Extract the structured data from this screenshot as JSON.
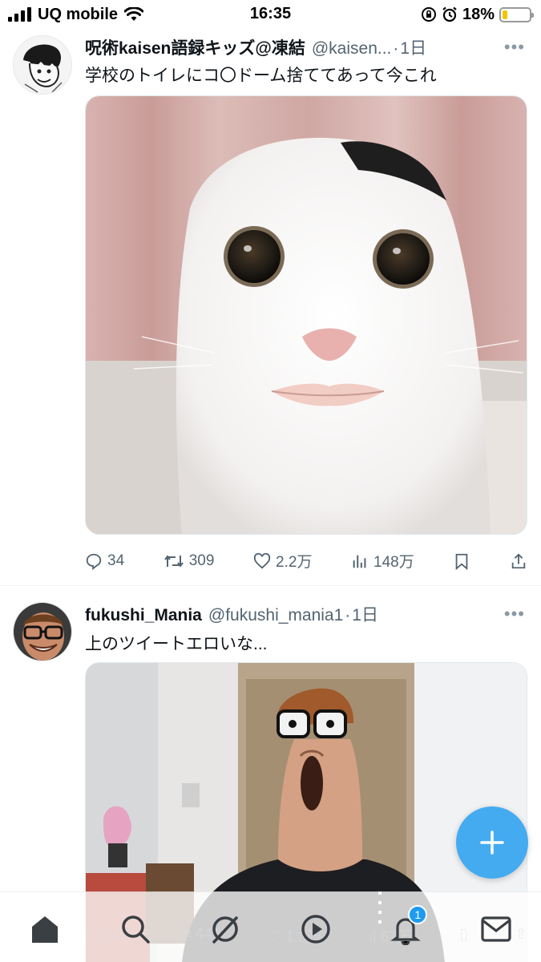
{
  "status_bar": {
    "carrier": "UQ mobile",
    "time": "16:35",
    "battery": "18%",
    "battery_level": 0.18,
    "battery_color": "#f5c400"
  },
  "tweets": [
    {
      "name": "呪術kaisen語録キッズ@凍結",
      "handle": "@kaisen...",
      "separator": "·",
      "time": "1日",
      "text": "学校のトイレにコ〇ドーム捨ててあって今これ",
      "more": "•••",
      "counts": {
        "reply": "34",
        "retweet": "309",
        "like": "2.2万",
        "views": "148万"
      }
    },
    {
      "name": "fukushi_Mania",
      "handle": "@fukushi_mania1",
      "separator": "·",
      "time": "1日",
      "text": "上のツイートエロいな...",
      "more": "•••",
      "counts": {
        "reply": "518",
        "retweet": "441",
        "like": "1.3万",
        "views": "67万"
      }
    }
  ],
  "bottom_nav": {
    "items": [
      "home-icon",
      "search-icon",
      "communities-icon",
      "video-icon",
      "notifications-icon",
      "messages-icon"
    ],
    "notification_badge": "1"
  },
  "colors": {
    "accent": "#1d9bf0",
    "text_primary": "#0f1419",
    "text_secondary": "#536471"
  }
}
